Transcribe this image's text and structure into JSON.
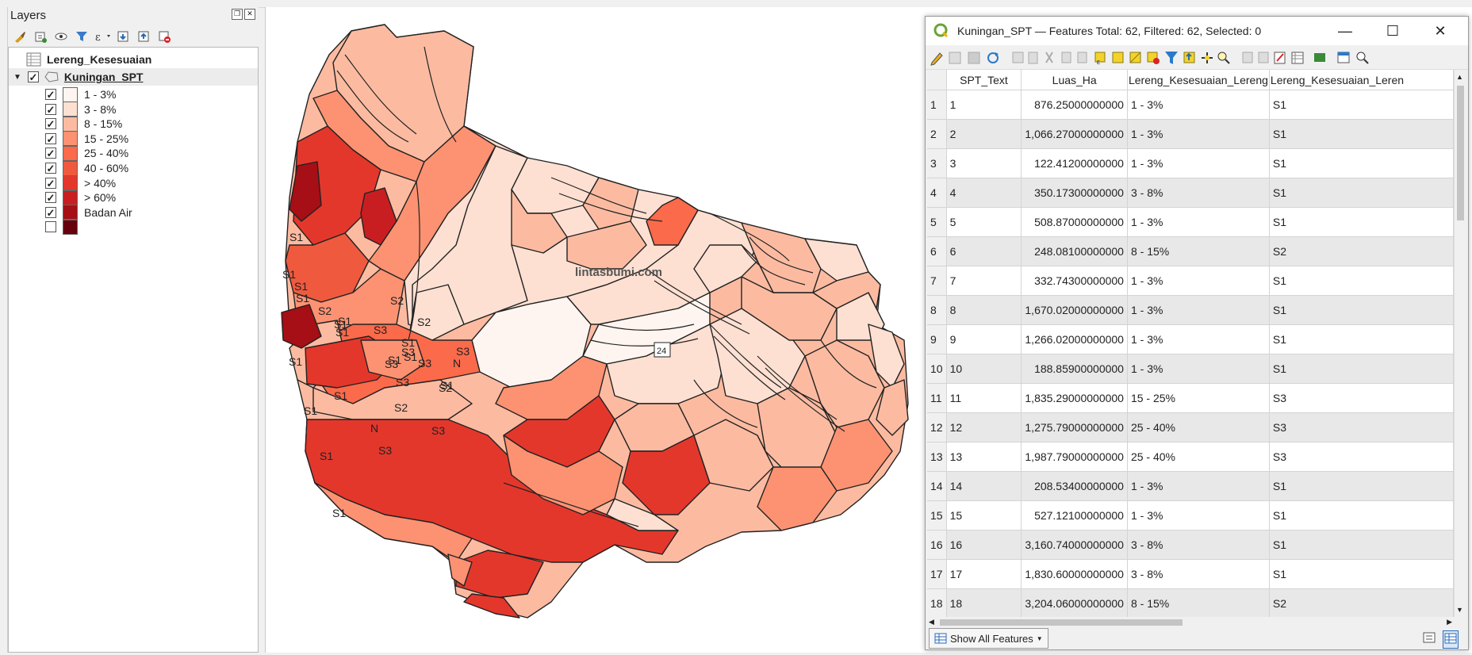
{
  "layers_panel": {
    "title": "Layers",
    "layers": [
      {
        "name": "Lereng_Kesesuaian"
      },
      {
        "name": "Kuningan_SPT"
      }
    ],
    "legend": [
      {
        "label": "1 - 3%",
        "color": "#fff5f0",
        "checked": true
      },
      {
        "label": "3 - 8%",
        "color": "#fee0d2",
        "checked": true
      },
      {
        "label": "8 - 15%",
        "color": "#fcbba1",
        "checked": true
      },
      {
        "label": "15 - 25%",
        "color": "#fc9272",
        "checked": true
      },
      {
        "label": "25 - 40%",
        "color": "#fb6a4a",
        "checked": true
      },
      {
        "label": "40 - 60%",
        "color": "#ef5a3f",
        "checked": true
      },
      {
        "label": "> 40%",
        "color": "#e4372c",
        "checked": true
      },
      {
        "label": "> 60%",
        "color": "#c81e22",
        "checked": true
      },
      {
        "label": "Badan Air",
        "color": "#a50f15",
        "checked": true
      },
      {
        "label": "",
        "color": "#67000d",
        "checked": false
      }
    ]
  },
  "map": {
    "watermark": "lintasbumi.com",
    "badge": "24",
    "zone_labels": [
      "S2",
      "S2",
      "N",
      "N",
      "N",
      "S3",
      "N",
      "S3",
      "S1",
      "S2",
      "S3",
      "S2",
      "S1",
      "S1",
      "S2",
      "S3",
      "S1",
      "S3",
      "S3",
      "S1",
      "S1",
      "S1",
      "S1",
      "S1",
      "S2",
      "S1",
      "S1",
      "S1",
      "S1",
      "S3",
      "S1",
      "S3",
      "S3",
      "S2",
      "S1",
      "S1",
      "S1",
      "S2",
      "S2",
      "S3",
      "S1",
      "S3",
      "S3",
      "N",
      "S3",
      "N",
      "S3",
      "S3",
      "N",
      "S3",
      "S3",
      "S1",
      "S1",
      "S1",
      "S1",
      "S1",
      "S1",
      "S2",
      "S3",
      "N",
      "S2"
    ]
  },
  "attr_window": {
    "title": "Kuningan_SPT — Features Total: 62, Filtered: 62, Selected: 0",
    "minimize": "—",
    "maximize": "☐",
    "close": "✕",
    "columns": [
      "SPT_Text",
      "Luas_Ha",
      "Lereng_Kesesuaian_Lereng",
      "Lereng_Kesesuaian_Leren"
    ],
    "rows": [
      {
        "n": "1",
        "spt": "1",
        "luas": "876.25000000000",
        "lereng": "1 - 3%",
        "kes": "S1"
      },
      {
        "n": "2",
        "spt": "2",
        "luas": "1,066.27000000000",
        "lereng": "1 - 3%",
        "kes": "S1"
      },
      {
        "n": "3",
        "spt": "3",
        "luas": "122.41200000000",
        "lereng": "1 - 3%",
        "kes": "S1"
      },
      {
        "n": "4",
        "spt": "4",
        "luas": "350.17300000000",
        "lereng": "3 - 8%",
        "kes": "S1"
      },
      {
        "n": "5",
        "spt": "5",
        "luas": "508.87000000000",
        "lereng": "1 - 3%",
        "kes": "S1"
      },
      {
        "n": "6",
        "spt": "6",
        "luas": "248.08100000000",
        "lereng": "8 - 15%",
        "kes": "S2"
      },
      {
        "n": "7",
        "spt": "7",
        "luas": "332.74300000000",
        "lereng": "1 - 3%",
        "kes": "S1"
      },
      {
        "n": "8",
        "spt": "8",
        "luas": "1,670.02000000000",
        "lereng": "1 - 3%",
        "kes": "S1"
      },
      {
        "n": "9",
        "spt": "9",
        "luas": "1,266.02000000000",
        "lereng": "1 - 3%",
        "kes": "S1"
      },
      {
        "n": "10",
        "spt": "10",
        "luas": "188.85900000000",
        "lereng": "1 - 3%",
        "kes": "S1"
      },
      {
        "n": "11",
        "spt": "11",
        "luas": "1,835.29000000000",
        "lereng": "15 - 25%",
        "kes": "S3"
      },
      {
        "n": "12",
        "spt": "12",
        "luas": "1,275.79000000000",
        "lereng": "25 - 40%",
        "kes": "S3"
      },
      {
        "n": "13",
        "spt": "13",
        "luas": "1,987.79000000000",
        "lereng": "25 - 40%",
        "kes": "S3"
      },
      {
        "n": "14",
        "spt": "14",
        "luas": "208.53400000000",
        "lereng": "1 - 3%",
        "kes": "S1"
      },
      {
        "n": "15",
        "spt": "15",
        "luas": "527.12100000000",
        "lereng": "1 - 3%",
        "kes": "S1"
      },
      {
        "n": "16",
        "spt": "16",
        "luas": "3,160.74000000000",
        "lereng": "3 - 8%",
        "kes": "S1"
      },
      {
        "n": "17",
        "spt": "17",
        "luas": "1,830.60000000000",
        "lereng": "3 - 8%",
        "kes": "S1"
      },
      {
        "n": "18",
        "spt": "18",
        "luas": "3,204.06000000000",
        "lereng": "8 - 15%",
        "kes": "S2"
      }
    ],
    "show_all": "Show All Features"
  }
}
